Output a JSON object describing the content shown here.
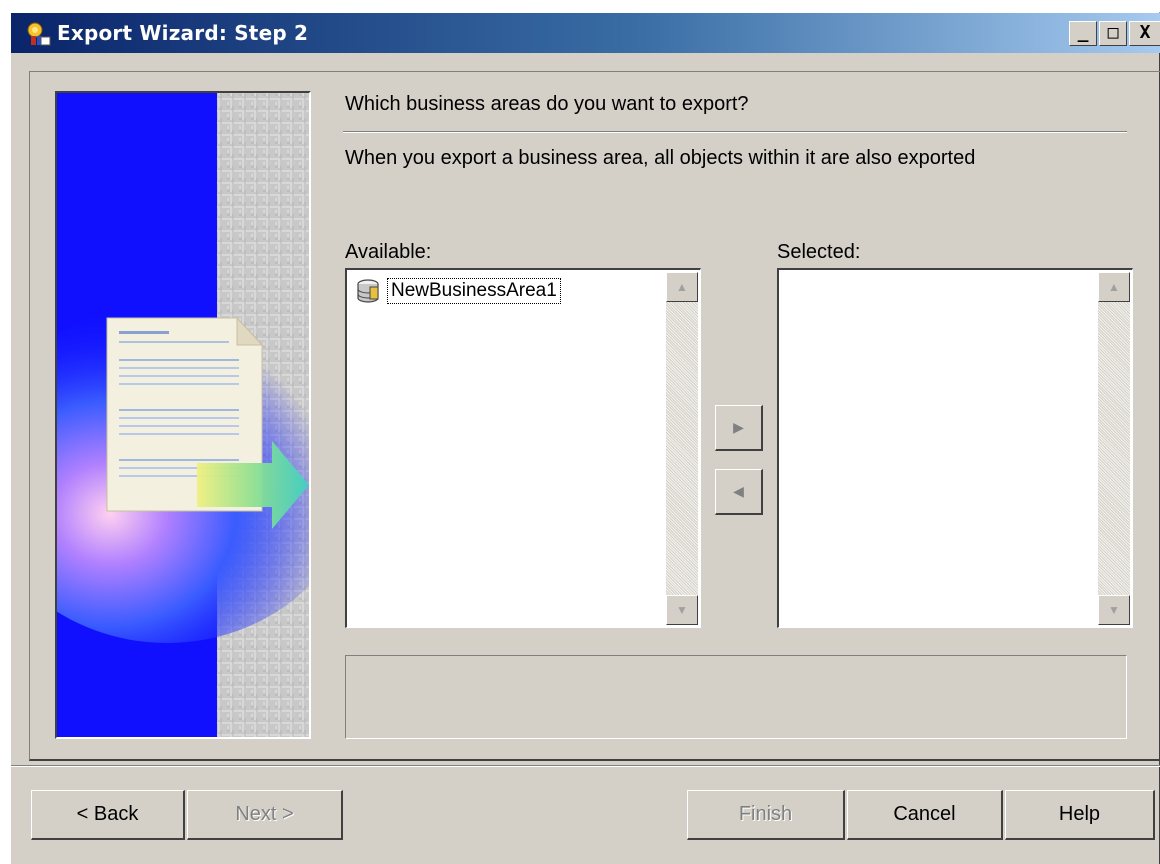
{
  "window": {
    "title": "Export Wizard: Step 2",
    "controls": {
      "minimize": "_",
      "maximize": "□",
      "close": "X"
    }
  },
  "wizard": {
    "question": "Which business areas do you want to export?",
    "description": "When you export a business area, all objects within it are also exported",
    "available_label": "Available:",
    "selected_label": "Selected:",
    "available_items": [
      {
        "label": "NewBusinessArea1",
        "icon": "business-area-icon"
      }
    ],
    "selected_items": [],
    "status_text": ""
  },
  "buttons": {
    "back": "< Back",
    "next": "Next >",
    "finish": "Finish",
    "cancel": "Cancel",
    "help": "Help"
  },
  "colors": {
    "dialog_face": "#d4d0c8",
    "titlebar_start": "#0a246a",
    "titlebar_end": "#a6caf0",
    "art_blue": "#1010ff"
  }
}
